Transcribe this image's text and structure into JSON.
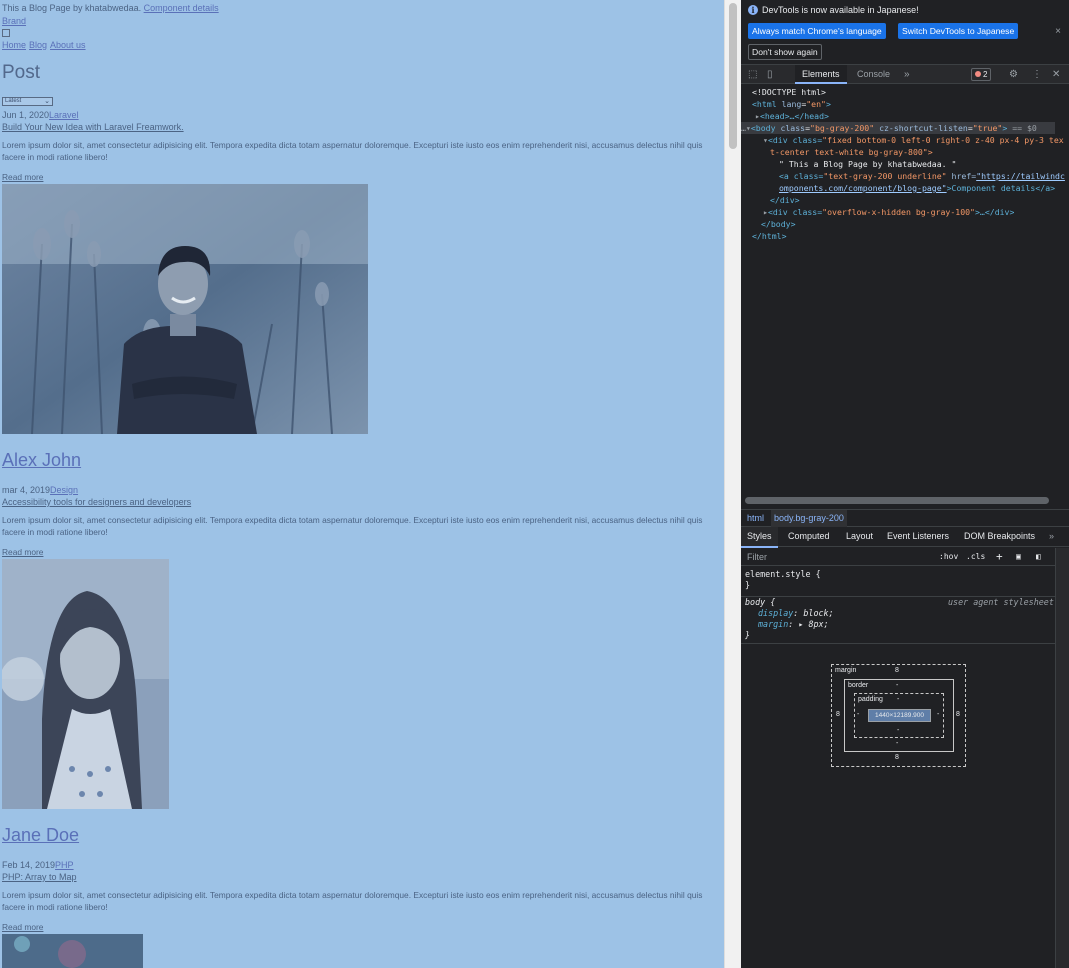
{
  "page": {
    "banner_text": "This a Blog Page by khatabwedaa.",
    "banner_link": "Component details",
    "brand": "Brand",
    "nav": [
      "Home",
      "Blog",
      "About us"
    ],
    "heading": "Post",
    "sort_select": "Latest",
    "posts": [
      {
        "date": "Jun 1, 2020",
        "category": "Laravel",
        "title": "Build Your New Idea with Laravel Freamwork.",
        "body": "Lorem ipsum dolor sit, amet consectetur adipisicing elit. Tempora expedita dicta totam aspernatur doloremque. Excepturi iste iusto eos enim reprehenderit nisi, accusamus delectus nihil quis facere in modi ratione libero!",
        "read_more": "Read more"
      },
      {
        "author": "Alex John",
        "date": "mar 4, 2019",
        "category": "Design",
        "title": "Accessibility tools for designers and developers",
        "body": "Lorem ipsum dolor sit, amet consectetur adipisicing elit. Tempora expedita dicta totam aspernatur doloremque. Excepturi iste iusto eos enim reprehenderit nisi, accusamus delectus nihil quis facere in modi ratione libero!",
        "read_more": "Read more"
      },
      {
        "author": "Jane Doe",
        "date": "Feb 14, 2019",
        "category": "PHP",
        "title": "PHP: Array to Map",
        "body": "Lorem ipsum dolor sit, amet consectetur adipisicing elit. Tempora expedita dicta totam aspernatur doloremque. Excepturi iste iusto eos enim reprehenderit nisi, accusamus delectus nihil quis facere in modi ratione libero!",
        "read_more": "Read more"
      }
    ]
  },
  "devtools": {
    "notice": "DevTools is now available in Japanese!",
    "btn_match": "Always match Chrome's language",
    "btn_switch": "Switch DevTools to Japanese",
    "btn_dont": "Don't show again",
    "tabs": [
      "Elements",
      "Console"
    ],
    "error_count": "2",
    "dom": {
      "l1": "<!DOCTYPE html>",
      "l2_tag": "<html",
      "l2_attr": "lang",
      "l2_val": "\"en\"",
      "l3": "<head>…</head>",
      "body_tag": "<body",
      "body_class": "\"bg-gray-200\"",
      "body_attr2": "cz-shortcut-listen",
      "body_val2": "\"true\"",
      "body_eq": "== $0",
      "div1_a": "<div class=",
      "div1_b": "\"fixed bottom-0 left-0 right-0 z-40 px-4 py-3 tex",
      "div1_c": "t-center text-white bg-gray-800\">",
      "text_node": "\" This a Blog Page by khatabwedaa. \"",
      "a_tag": "<a class=",
      "a_class": "\"text-gray-200 underline\"",
      "a_href_attr": " href=",
      "a_href": "\"https://tailwindc",
      "a_href2": "omponents.com/component/blog-page\"",
      "a_text": ">Component details</a>",
      "div_close": "</div>",
      "div2_a": "<div class=",
      "div2_b": "\"overflow-x-hidden bg-gray-100\"",
      "div2_c": ">…</div>",
      "body_close": "</body>",
      "html_close": "</html>"
    },
    "crumbs": [
      "html",
      "body.bg-gray-200"
    ],
    "style_tabs": [
      "Styles",
      "Computed",
      "Layout",
      "Event Listeners",
      "DOM Breakpoints"
    ],
    "filter_placeholder": "Filter",
    "hov": ":hov",
    "cls": ".cls",
    "styles": {
      "element_style": "element.style {",
      "close": "}",
      "body_sel": "body {",
      "ua": "user agent stylesheet",
      "display_prop": "display",
      "display_val": "block;",
      "margin_prop": "margin",
      "margin_val": "8px;"
    },
    "box": {
      "margin": "margin",
      "border": "border",
      "padding": "padding",
      "margin_val": "8",
      "dash": "-",
      "content": "1440×12189.900"
    }
  }
}
